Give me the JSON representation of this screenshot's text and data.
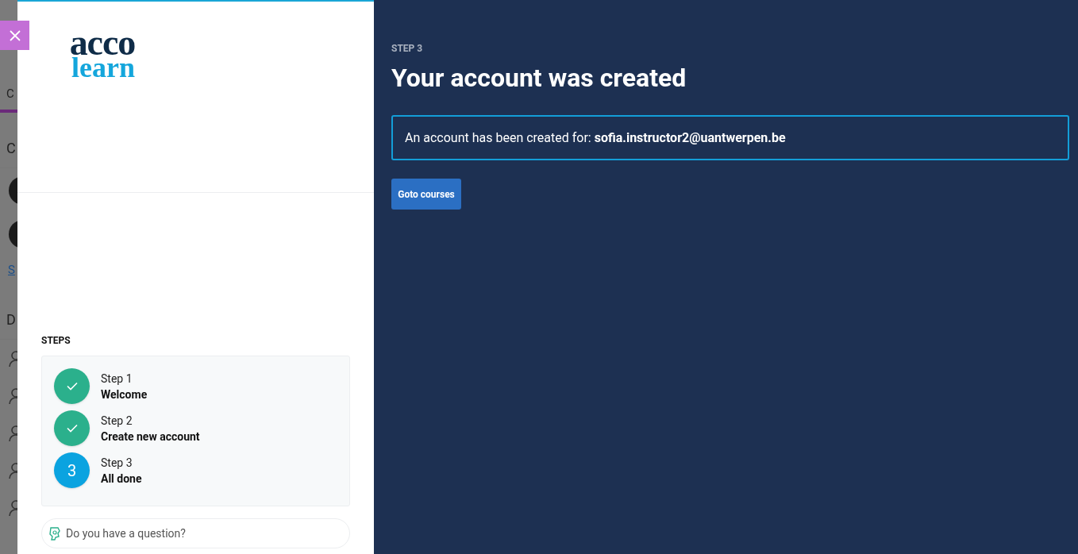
{
  "background_page": {
    "fragments": [
      {
        "kind": "tab",
        "text": "C"
      },
      {
        "kind": "heading",
        "text": "C"
      },
      {
        "kind": "avatar"
      },
      {
        "kind": "avatar"
      },
      {
        "kind": "link",
        "text": "S"
      },
      {
        "kind": "heading",
        "text": "D"
      },
      {
        "kind": "icon"
      },
      {
        "kind": "icon"
      },
      {
        "kind": "icon"
      },
      {
        "kind": "icon"
      },
      {
        "kind": "icon"
      }
    ]
  },
  "logo": {
    "top": "acco",
    "bottom": "learn"
  },
  "steps": {
    "title": "STEPS",
    "items": [
      {
        "label": "Step 1",
        "name": "Welcome",
        "done": true
      },
      {
        "label": "Step 2",
        "name": "Create new account",
        "done": true
      },
      {
        "label": "Step 3",
        "name": "All done",
        "done": false,
        "badge": "3"
      }
    ]
  },
  "question": {
    "placeholder": "Do you have a question?"
  },
  "main": {
    "eyebrow": "STEP 3",
    "title": "Your account was created",
    "message": "An account has been created for: **sofia.instructor2@uantwerpen.be**",
    "button": "Goto courses"
  }
}
